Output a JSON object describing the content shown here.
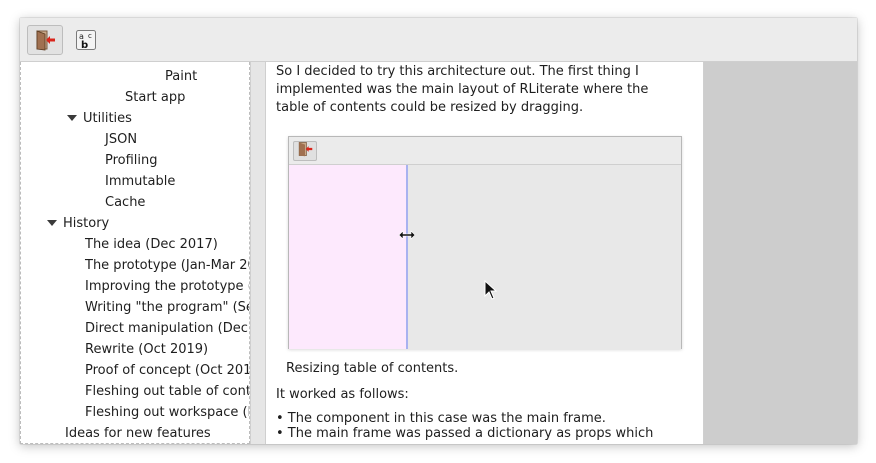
{
  "toolbar": {
    "buttons": [
      {
        "icon": "quit-icon",
        "active": true
      },
      {
        "icon": "spellcheck-icon",
        "active": false
      }
    ],
    "spell_letters": {
      "a": "a",
      "b": "b",
      "c": "c"
    }
  },
  "toc": {
    "items": [
      {
        "label": "Paint",
        "indent": 0
      },
      {
        "label": "Start app",
        "indent": 0
      },
      {
        "label": "Utilities",
        "expanded": true
      },
      {
        "label": "JSON"
      },
      {
        "label": "Profiling"
      },
      {
        "label": "Immutable"
      },
      {
        "label": "Cache"
      },
      {
        "label": "History",
        "expanded": true
      },
      {
        "label": "The idea (Dec 2017)"
      },
      {
        "label": "The prototype (Jan-Mar 20"
      },
      {
        "label": "Improving the prototype ("
      },
      {
        "label": "Writing \"the program\" (Se"
      },
      {
        "label": "Direct manipulation (Dec"
      },
      {
        "label": "Rewrite (Oct 2019)"
      },
      {
        "label": "Proof of concept (Oct 201"
      },
      {
        "label": "Fleshing out table of cont"
      },
      {
        "label": "Fleshing out workspace (N"
      },
      {
        "label": "Ideas for new features"
      }
    ]
  },
  "document": {
    "intro_lines": [
      "So I decided to try this architecture out. The first thing I",
      "implemented was the main layout of RLiterate where the",
      "table of contents could be resized by dragging."
    ],
    "caption": "Resizing table of contents.",
    "follows": "It worked as follows:",
    "bullets": [
      "• The component in this case was the main frame.",
      "• The main frame was passed a dictionary as props which"
    ]
  },
  "colors": {
    "figure_toc_bg": "#fde9fd",
    "figure_divider": "#a8b2f0",
    "quit_red": "#d9261c"
  }
}
